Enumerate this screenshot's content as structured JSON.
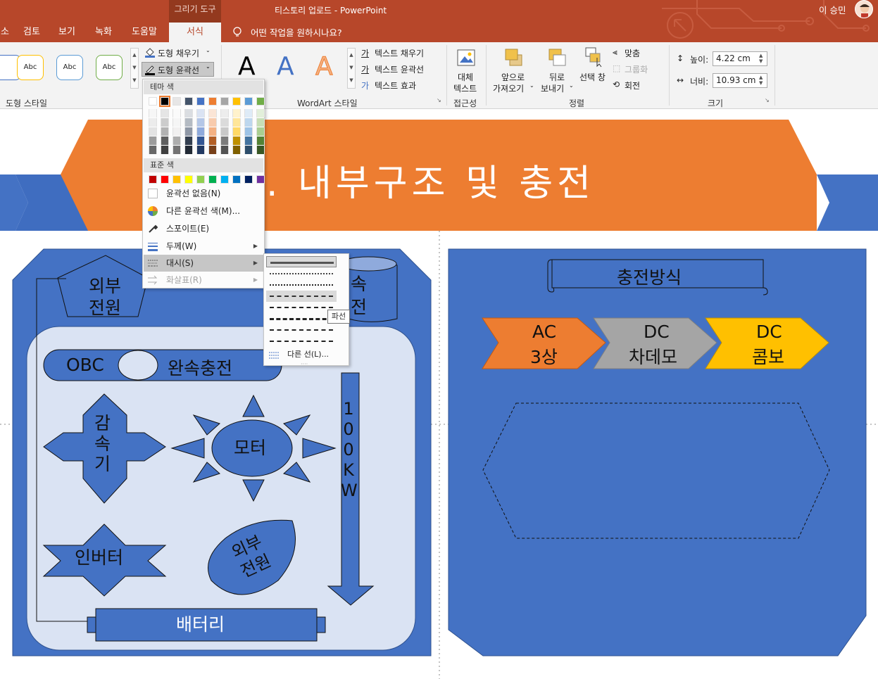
{
  "window": {
    "doc_title": "티스토리 업로드  -  PowerPoint",
    "context_group": "그리기 도구",
    "user_name": "이 승민"
  },
  "tabs": [
    {
      "label": "소"
    },
    {
      "label": "검토"
    },
    {
      "label": "보기"
    },
    {
      "label": "녹화"
    },
    {
      "label": "도움말"
    },
    {
      "label": "서식",
      "active": true
    }
  ],
  "tell_me": "어떤 작업을 원하시나요?",
  "ribbon": {
    "shape_styles": {
      "group_label": "도형 스타일",
      "swatches": [
        "Abc",
        "Abc",
        "Abc"
      ],
      "fill": "도형 채우기",
      "outline": "도형 윤곽선"
    },
    "wordart": {
      "group_label": "WordArt 스타일",
      "letter": "A",
      "text_fill": "텍스트 채우기",
      "text_outline": "텍스트 윤곽선",
      "text_effects": "텍스트 효과"
    },
    "accessibility": {
      "group_label": "접근성",
      "alt_text_line1": "대체",
      "alt_text_line2": "텍스트"
    },
    "arrange": {
      "group_label": "정렬",
      "bring_forward_line1": "앞으로",
      "bring_forward_line2": "가져오기",
      "send_backward_line1": "뒤로",
      "send_backward_line2": "보내기",
      "selection_pane": "선택 창",
      "align": "맞춤",
      "group": "그룹화",
      "rotate": "회전"
    },
    "size": {
      "group_label": "크기",
      "height_label": "높이:",
      "height_value": "4.22 cm",
      "width_label": "너비:",
      "width_value": "10.93 cm"
    }
  },
  "outline_menu": {
    "theme_colors_header": "테마 색",
    "standard_colors_header": "표준 색",
    "no_outline": "윤곽선 없음(N)",
    "more_colors": "다른 윤곽선 색(M)...",
    "eyedropper": "스포이트(E)",
    "weight": "두께(W)",
    "dashes": "대시(S)",
    "arrows": "화살표(R)",
    "theme_top_row": [
      "#ffffff",
      "#000000",
      "#e7e6e6",
      "#44546a",
      "#4472c4",
      "#ed7d31",
      "#a5a5a5",
      "#ffc000",
      "#5b9bd5",
      "#70ad47"
    ],
    "standard_colors": [
      "#c00000",
      "#ff0000",
      "#ffc000",
      "#ffff00",
      "#92d050",
      "#00b050",
      "#00b0f0",
      "#0070c0",
      "#002060",
      "#7030a0"
    ]
  },
  "dash_menu": {
    "more_lines": "다른 선(L)...",
    "tooltip": "파선"
  },
  "slide": {
    "title": ". 내부구조 및 충전",
    "title_color": "#ed7d31",
    "panel_color": "#4472c4",
    "left": {
      "external_power_top": "외부\n전원",
      "connector_partial": "속\n전",
      "obc": "OBC",
      "fast_charge": "완속충전",
      "reducer": "감\n속\n기",
      "motor": "모터",
      "power_100kw": "1\n0\n0\nK\nW",
      "inverter": "인버터",
      "external_power_bottom": "외부\n전원",
      "battery": "배터리"
    },
    "right": {
      "charging_title": "충전방식",
      "chevrons": [
        {
          "line1": "AC",
          "line2": "3상",
          "color": "#ed7d31"
        },
        {
          "line1": "DC",
          "line2": "차데모",
          "color": "#a5a5a5"
        },
        {
          "line1": "DC",
          "line2": "콤보",
          "color": "#ffc000"
        }
      ]
    }
  }
}
